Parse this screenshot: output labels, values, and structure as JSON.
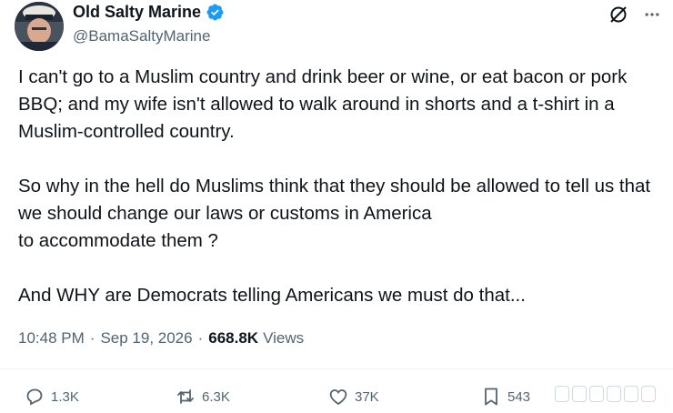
{
  "author": {
    "display_name": "Old Salty Marine",
    "handle": "@BamaSaltyMarine",
    "verified": true
  },
  "top_actions": {
    "grok_icon": "grok-icon",
    "more_icon": "more-horizontal-icon"
  },
  "tweet": {
    "paragraphs": [
      "I can't go to a Muslim country and drink beer or wine, or eat bacon or pork BBQ; and my wife isn't allowed to walk around in shorts and a t-shirt in a Muslim-controlled country.",
      "So why in the hell do Muslims think that they should be allowed to tell us that we should change our laws or customs in America",
      "to accommodate them ?",
      "And WHY are Democrats telling Americans we must do that..."
    ]
  },
  "meta": {
    "time": "10:48 PM",
    "date": "Sep 19, 2026",
    "views_count": "668.8K",
    "views_label": "Views"
  },
  "actions": {
    "replies": "1.3K",
    "reposts": "6.3K",
    "likes": "37K",
    "bookmarks": "543"
  },
  "colors": {
    "verified": "#1d9bf0",
    "secondary_text": "#536471",
    "primary_text": "#0f1419"
  }
}
